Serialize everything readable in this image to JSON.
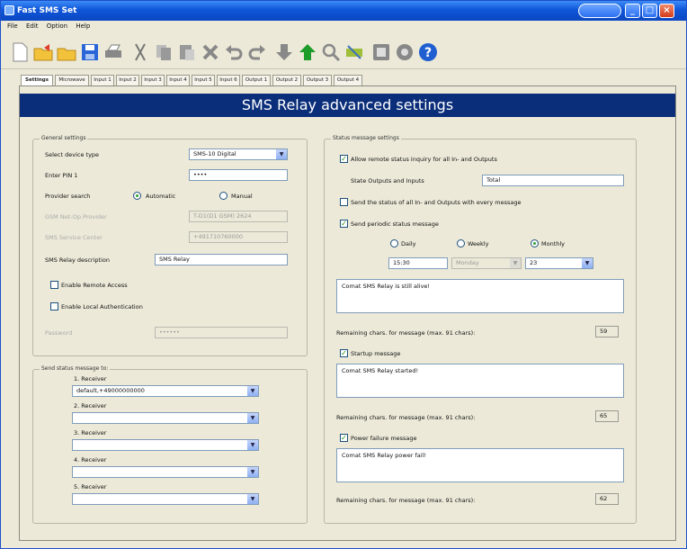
{
  "window": {
    "title": "Fast SMS Set",
    "controls": [
      "minimize",
      "maximize",
      "close"
    ]
  },
  "menu": [
    "File",
    "Edit",
    "Option",
    "Help"
  ],
  "toolbar": {
    "icons": [
      "new-icon",
      "open-folder-icon",
      "open-icon",
      "save-icon",
      "print-icon",
      "cut-icon",
      "copy-icon",
      "paste-icon",
      "delete-icon",
      "undo-icon",
      "redo-icon",
      "download-icon",
      "upload-icon",
      "search-icon",
      "connect-icon",
      "device-icon",
      "settings-icon",
      "help-icon"
    ]
  },
  "tabs": [
    "Settings",
    "Microwave",
    "Input 1",
    "Input 2",
    "Input 3",
    "Input 4",
    "Input 5",
    "Input 6",
    "Output 1",
    "Output 2",
    "Output 3",
    "Output 4"
  ],
  "banner": "SMS Relay advanced settings",
  "general": {
    "legend": "General settings",
    "device_type_label": "Select device type",
    "device_type_value": "SMS-10 Digital",
    "pin_label": "Enter PIN 1",
    "pin_value": "••••",
    "provider_label": "Provider search",
    "provider_auto": "Automatic",
    "provider_manual": "Manual",
    "gsm_label": "GSM Net-Op.Provider",
    "gsm_value": "T-D1(D1 GSM) 2624",
    "service_center_label": "SMS Service Center",
    "service_center_value": "+491710760000",
    "description_label": "SMS Relay description",
    "description_value": "SMS Relay",
    "remote_access": "Enable Remote Access",
    "local_auth": "Enable Local Authentication",
    "password_label": "Password",
    "password_value": "••••••"
  },
  "send_status": {
    "legend": "Send status message to:",
    "receivers": [
      {
        "label": "1. Receiver",
        "value": "default,+49000000000"
      },
      {
        "label": "2. Receiver",
        "value": ""
      },
      {
        "label": "3. Receiver",
        "value": ""
      },
      {
        "label": "4. Receiver",
        "value": ""
      },
      {
        "label": "5. Receiver",
        "value": ""
      }
    ]
  },
  "status_msg": {
    "legend": "Status message settings",
    "allow_inquiry": "Allow remote status inquiry for all In- and Outputs",
    "state_label": "State Outputs and Inputs",
    "state_value": "Total",
    "send_every": "Send the status of all In- and Outputs with every message",
    "periodic": "Send periodic status message",
    "daily": "Daily",
    "weekly": "Weekly",
    "monthly": "Monthly",
    "time_value": "15:30",
    "weekday_value": "Monday",
    "day_value": "23",
    "periodic_text": "Comat SMS Relay is still alive!",
    "remaining_label": "Remaining chars. for message (max. 91 chars):",
    "remaining1": "59",
    "startup": "Startup message",
    "startup_text": "Comat SMS Relay started!",
    "remaining2": "65",
    "power_fail": "Power failure message",
    "power_text": "Comat SMS Relay power fail!",
    "remaining3": "62"
  }
}
